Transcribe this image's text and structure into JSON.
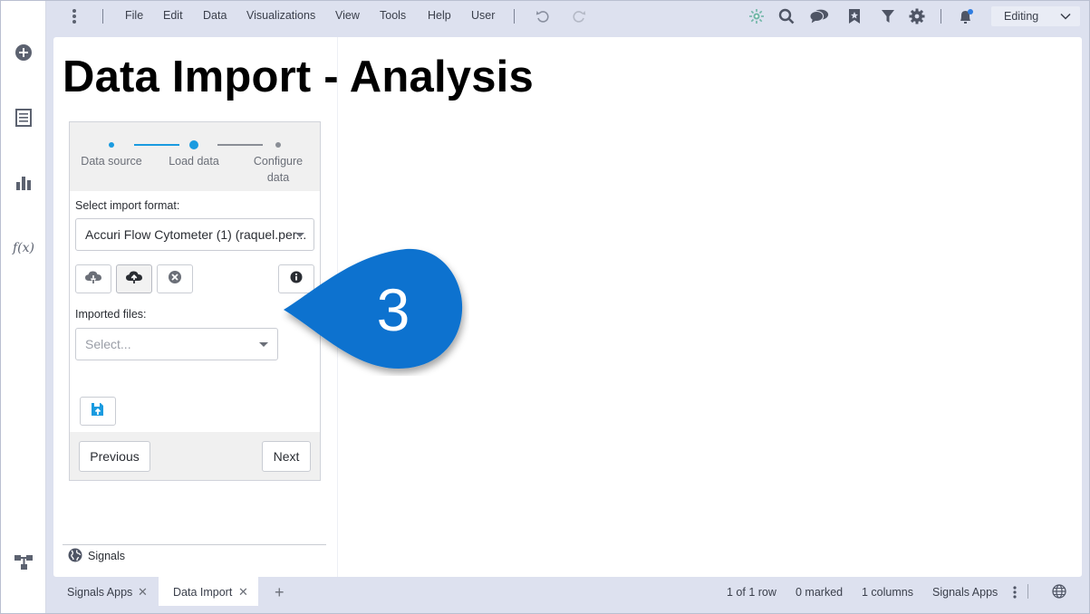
{
  "menu": {
    "items": [
      "File",
      "Edit",
      "Data",
      "Visualizations",
      "View",
      "Tools",
      "Help",
      "User"
    ],
    "mode": "Editing"
  },
  "icons": {
    "rail": [
      "add-icon",
      "pages-icon",
      "visualizations-icon",
      "data-functions-icon",
      "data-canvas-icon"
    ],
    "toolbar": [
      "kebab-icon",
      "undo-icon",
      "redo-icon",
      "recommendations-icon",
      "search-icon",
      "comments-icon",
      "bookmarks-icon",
      "filter-icon",
      "settings-icon",
      "notifications-icon"
    ]
  },
  "page": {
    "title": "Data Import - Analysis"
  },
  "wizard": {
    "steps": [
      {
        "label": "Data source",
        "state": "done"
      },
      {
        "label": "Load data",
        "state": "current"
      },
      {
        "label": "Configure data",
        "state": "pending"
      }
    ],
    "format_label": "Select import format:",
    "format_value": "Accuri Flow Cytometer (1) (raquel.per...",
    "imported_label": "Imported files:",
    "imported_placeholder": "Select...",
    "previous_label": "Previous",
    "next_label": "Next"
  },
  "signals_footer": {
    "label": "Signals"
  },
  "callout": {
    "number": "3",
    "color": "#0a72cf"
  },
  "bottom": {
    "tabs": [
      {
        "label": "Signals Apps",
        "active": false
      },
      {
        "label": "Data Import",
        "active": true
      }
    ],
    "status": {
      "rows": "1 of 1 row",
      "marked": "0 marked",
      "columns": "1 columns",
      "app": "Signals Apps"
    }
  },
  "colors": {
    "accent": "#1a9be0",
    "chrome": "#dde1ef"
  }
}
